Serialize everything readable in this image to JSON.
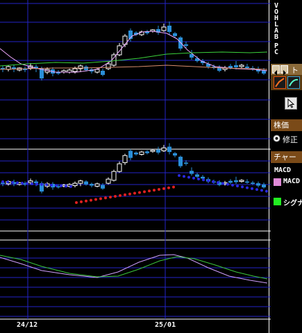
{
  "price_axis_letters": [
    "V",
    "O",
    "H",
    "L",
    "A",
    "B",
    "P",
    "C"
  ],
  "toolbar": {
    "nav_left_icon": "caret-left-icon",
    "nav_right_icon": "caret-right-icon",
    "tab_label": "ト",
    "pointer_icon": "cursor-arrow-icon"
  },
  "side_panel": {
    "stock_price_header": "株価",
    "adjusted_option_label": "修正",
    "chart_header": "チャー",
    "macd_label": "MACD",
    "macd_series_label": "MACD",
    "signal_series_label": "シグナ"
  },
  "colors": {
    "background": "#000000",
    "grid": "#2424c8",
    "candle_up": "#ffffff",
    "candle_down": "#2a8fd8",
    "sma_short": "#f0a8ff",
    "sma_long": "#3cd23c",
    "sma_mid": "#d98e6e",
    "psar_bull": "#2a2ae0",
    "psar_bear": "#e02020",
    "macd": "#d2a0ff",
    "signal": "#3cc83c",
    "header_bg": "#7a4a18"
  },
  "chart_data": {
    "type": "candlestick",
    "x_tick_labels": [
      "24/12",
      "25/01"
    ],
    "panels": [
      "price",
      "parabolic_sar",
      "macd"
    ],
    "legend": [
      {
        "name": "MACD",
        "color": "#d2a0ff"
      },
      {
        "name": "シグナ",
        "color": "#3cc83c"
      }
    ]
  }
}
